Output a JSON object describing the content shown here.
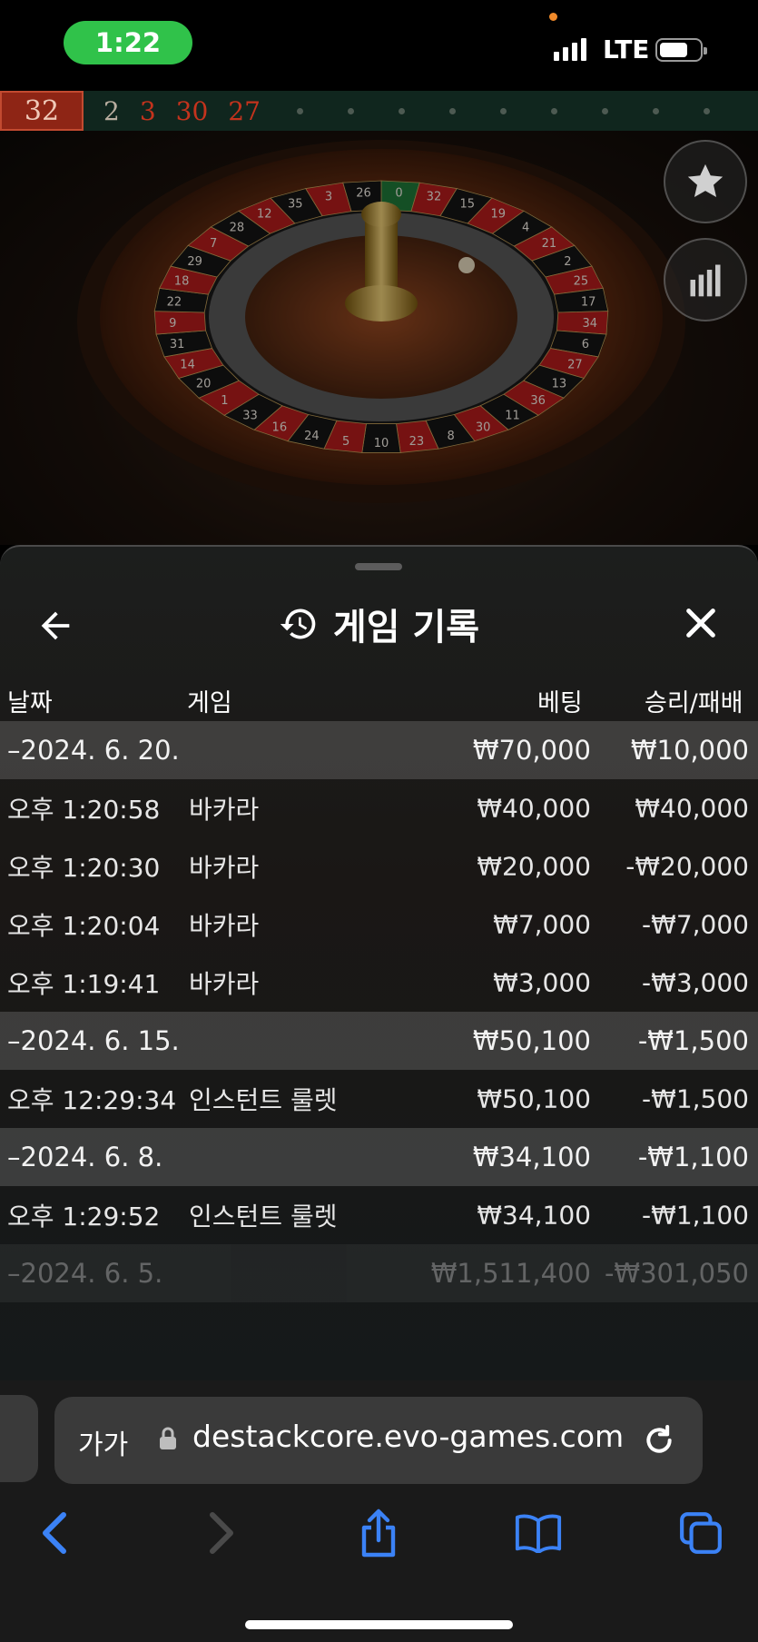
{
  "status_bar": {
    "time": "1:22",
    "network": "LTE"
  },
  "roulette": {
    "last_result": "32",
    "recent_results": [
      {
        "value": "2",
        "color": "black"
      },
      {
        "value": "3",
        "color": "red"
      },
      {
        "value": "30",
        "color": "red"
      },
      {
        "value": "27",
        "color": "red"
      }
    ],
    "wheel_numbers": [
      "0",
      "32",
      "15",
      "19",
      "4",
      "21",
      "2",
      "25",
      "17",
      "34",
      "6",
      "27",
      "13",
      "36",
      "11",
      "30",
      "8",
      "23",
      "10",
      "5",
      "24",
      "16",
      "33",
      "1",
      "20",
      "14",
      "31",
      "9",
      "22",
      "18",
      "29",
      "7",
      "28",
      "12",
      "35",
      "3",
      "26"
    ]
  },
  "sheet": {
    "title": "게임 기록",
    "columns": {
      "date": "날짜",
      "game": "게임",
      "bet": "베팅",
      "win_loss": "승리/패배"
    },
    "groups": [
      {
        "date": "–2024. 6. 20.",
        "bet": "₩70,000",
        "win_loss": "₩10,000",
        "entries": [
          {
            "time": "오후 1:20:58",
            "game": "바카라",
            "bet": "₩40,000",
            "win_loss": "₩40,000"
          },
          {
            "time": "오후 1:20:30",
            "game": "바카라",
            "bet": "₩20,000",
            "win_loss": "-₩20,000"
          },
          {
            "time": "오후 1:20:04",
            "game": "바카라",
            "bet": "₩7,000",
            "win_loss": "-₩7,000"
          },
          {
            "time": "오후 1:19:41",
            "game": "바카라",
            "bet": "₩3,000",
            "win_loss": "-₩3,000"
          }
        ]
      },
      {
        "date": "–2024. 6. 15.",
        "bet": "₩50,100",
        "win_loss": "-₩1,500",
        "entries": [
          {
            "time": "오후 12:29:34",
            "game": "인스턴트 룰렛",
            "bet": "₩50,100",
            "win_loss": "-₩1,500"
          }
        ]
      },
      {
        "date": "–2024. 6. 8.",
        "bet": "₩34,100",
        "win_loss": "-₩1,100",
        "entries": [
          {
            "time": "오후 1:29:52",
            "game": "인스턴트 룰렛",
            "bet": "₩34,100",
            "win_loss": "-₩1,100"
          }
        ]
      },
      {
        "date": "–2024. 6. 5.",
        "bet": "₩1,511,400",
        "win_loss": "-₩301,050",
        "entries": []
      }
    ]
  },
  "browser": {
    "text_size_label": "가가",
    "url": "destackcore.evo-games.com"
  },
  "colors": {
    "accent_blue": "#3b82f6",
    "time_pill": "#30c24a",
    "roulette_red": "#c4331d"
  },
  "icons": [
    "back-arrow-icon",
    "history-icon",
    "close-icon",
    "star-icon",
    "bar-chart-icon",
    "lock-icon",
    "reload-icon",
    "chevron-left-icon",
    "chevron-right-icon",
    "share-icon",
    "book-icon",
    "tabs-icon"
  ]
}
